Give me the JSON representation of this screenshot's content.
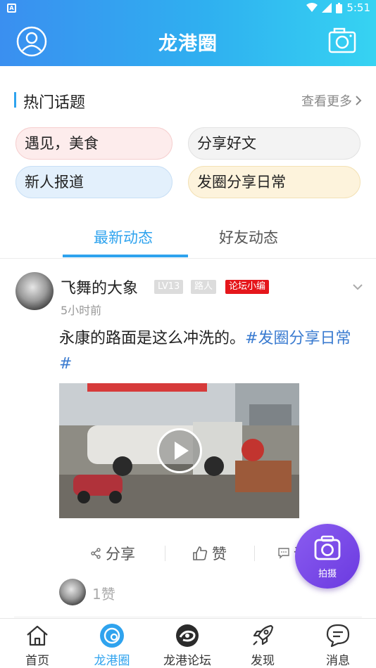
{
  "status_bar": {
    "time": "5:51",
    "app_icon": "A"
  },
  "header": {
    "title": "龙港圈",
    "left_icon": "user-icon",
    "right_icon": "camera-icon"
  },
  "hot_topics": {
    "title": "热门话题",
    "more_label": "查看更多",
    "chips": [
      {
        "label": "遇见，美食"
      },
      {
        "label": "分享好文"
      },
      {
        "label": "新人报道"
      },
      {
        "label": "发圈分享日常"
      }
    ]
  },
  "tabs": [
    {
      "label": "最新动态",
      "active": true
    },
    {
      "label": "好友动态",
      "active": false
    }
  ],
  "post": {
    "author": "飞舞的大象",
    "level_badge": "LV13",
    "rank_badge": "路人",
    "role_badge": "论坛小编",
    "time": "5小时前",
    "text": "永康的路面是这么冲洗的。",
    "tag": "#发圈分享日常#",
    "actions": {
      "share": "分享",
      "like": "赞",
      "comment": "评"
    },
    "like_count": "1赞"
  },
  "fab": {
    "label": "拍摄"
  },
  "bottom_nav": [
    {
      "label": "首页",
      "icon": "home-icon",
      "active": false
    },
    {
      "label": "龙港圈",
      "icon": "circle-icon",
      "active": true
    },
    {
      "label": "龙港论坛",
      "icon": "forum-icon",
      "active": false
    },
    {
      "label": "发现",
      "icon": "rocket-icon",
      "active": false
    },
    {
      "label": "消息",
      "icon": "message-icon",
      "active": false
    }
  ],
  "colors": {
    "accent": "#2fa3ee",
    "editor_badge": "#e5161b",
    "fab": "#7a4ae8"
  }
}
